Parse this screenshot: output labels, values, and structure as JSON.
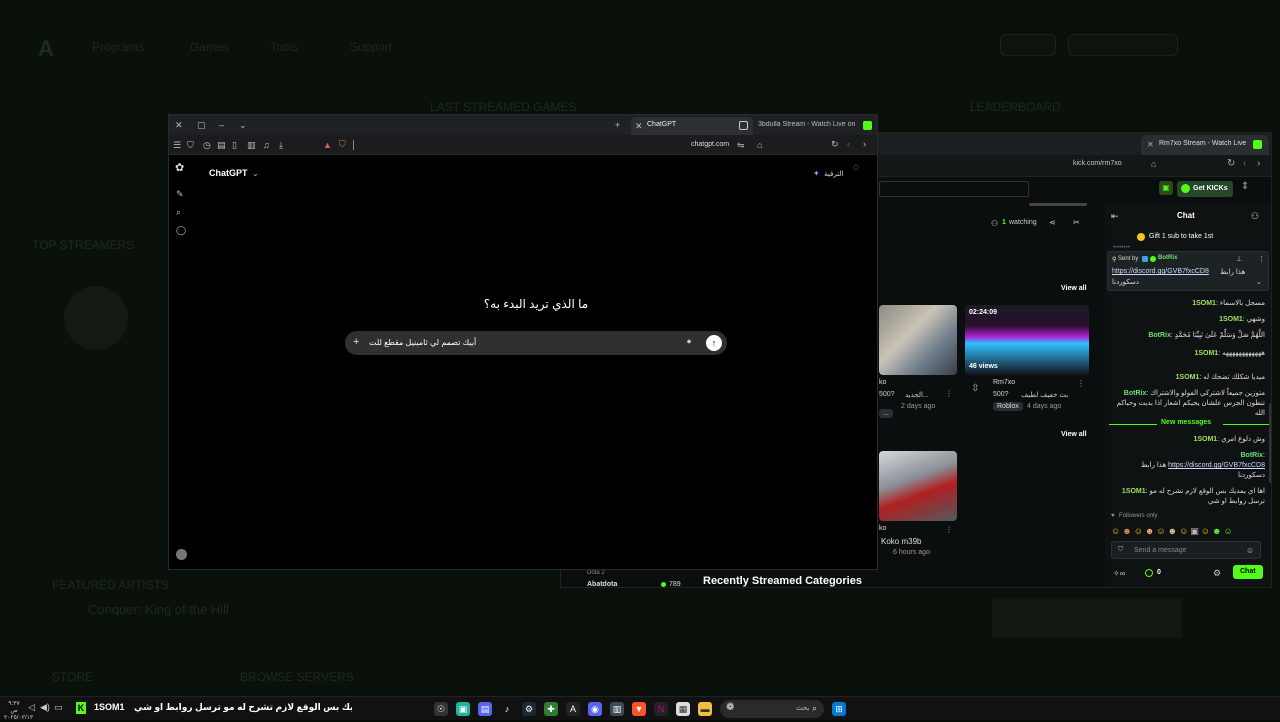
{
  "background": {
    "nav": [
      "Programs",
      "Games",
      "Tools",
      "Support"
    ],
    "left_labels": [
      "TOP STREAMERS",
      "FEATURED ARTISTS",
      "STORE",
      "BROWSE SERVERS"
    ],
    "featured_title": "Conquer: King of the Hill",
    "headings": [
      "LAST STREAMED GAMES",
      "LEADERBOARD"
    ]
  },
  "chatgpt_window": {
    "tabs": [
      {
        "label": "ChatGPT",
        "active": true
      },
      {
        "label": "3bdulla Stream - Watch Live on Kick",
        "active": false
      }
    ],
    "address": "chatgpt.com",
    "app_title": "ChatGPT",
    "upgrade_label": "الترقية",
    "prompt_heading": "ما الذي تريد البدء به؟",
    "input_value": "أبيك تصمم لي ثامبنيل مقطع للت"
  },
  "kick_window": {
    "tab_label": "Rm7xo Stream - Watch Live on Kick",
    "address": "kick.com/rm7xo",
    "get_kicks_label": "Get KICKs",
    "watching_count": "1",
    "watching_label": "watching",
    "view_all": "View all",
    "videos": [
      {
        "duration": "",
        "views": "",
        "title": "الجديد...",
        "channel": "ko",
        "meta": "2 days ago",
        "stat": "500?"
      },
      {
        "duration": "02:24:09",
        "views": "46 views",
        "title": "بث خفيف لطيف",
        "channel": "Rm7xo",
        "meta": "4 days ago",
        "stat": "500?",
        "tag": "Roblox"
      },
      {
        "duration": "",
        "views": "",
        "title": "",
        "channel": "Koko m39b",
        "meta": "6 hours ago",
        "stat": ""
      }
    ],
    "recent_categories": "Recently Streamed Categories",
    "category_row": {
      "game": "Dota 2",
      "name": "Abatdota",
      "viewers": "789"
    },
    "chat": {
      "title": "Chat",
      "gift_banner": "Gift 1 sub to take 1st",
      "pinned_sent_by": "Sent by",
      "pinned_user": "BotRix",
      "pinned_link": "https://discord.gg/GVB7fxcCD8",
      "pinned_text_a": "هذا رابط",
      "pinned_text_b": "دسكوردنا",
      "messages": [
        {
          "user": "1SOM1",
          "text": "مسجل بالاسماء"
        },
        {
          "user": "1SOM1",
          "text": "وشهي"
        },
        {
          "user": "BotRix",
          "text": "اللَّهُمَّ صَلِّ وَسَلِّمْ عَلَىٰ نَبِيِّنَا مُحَمَّدٍ"
        },
        {
          "user": "1SOM1",
          "text": "ههههههههههههه"
        },
        {
          "user": "1SOM1",
          "text": "ميديا شكلك تضحك له"
        },
        {
          "user": "BotRix",
          "text": "متوزين جميعاً لاشتركي الفولو والاشتراك تنطون الجرس علشان يجيكم اشعار اذا بديت وحياكم الله"
        }
      ],
      "new_messages": "New messages",
      "messages_after": [
        {
          "user": "1SOM1",
          "text": "وش دلوع امري"
        },
        {
          "user": "BotRix",
          "text": "هذا رابط",
          "link": "https://discord.gg/GVB7fxcCD8",
          "text2": "دسكوردنا"
        },
        {
          "user": "1SOM1",
          "text": "اها اي يمديك بس الوقع لازم تشرح له مو ترسل روابط او شي"
        }
      ],
      "followers_only": "Followers only",
      "send_placeholder": "Send a message",
      "chat_button": "Chat",
      "points": "0"
    }
  },
  "taskbar": {
    "notification_text": "اها اي يمديك بس الوقع لازم تشرح له مو ترسل روابط او شي",
    "notification_user": "1SOM1",
    "search_placeholder": "بحث",
    "time": "٩:٣٧ ص",
    "date": "٢٠٢٥/٠٢/١٣"
  },
  "colors": {
    "kick_green": "#53fc18",
    "bot_green": "#6ee06e"
  }
}
